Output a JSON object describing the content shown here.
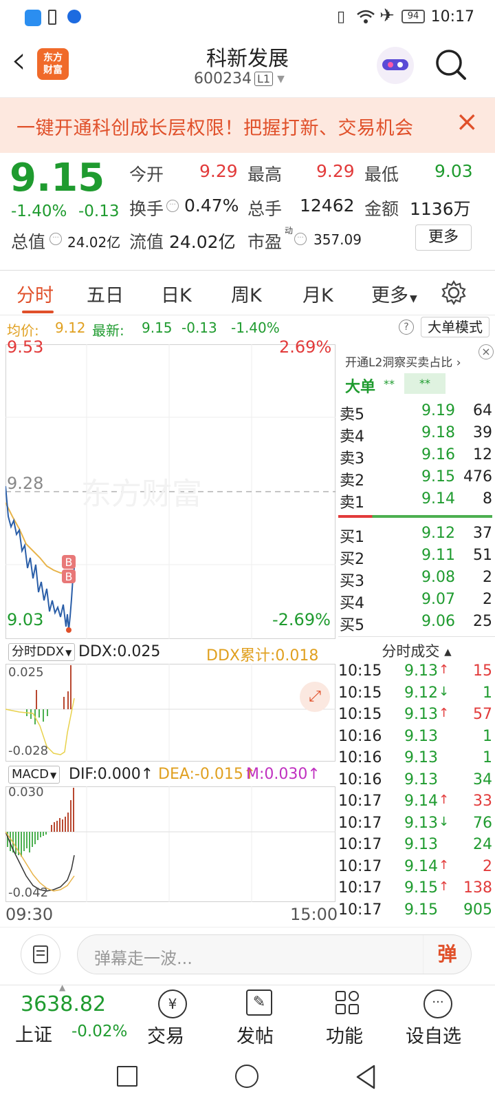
{
  "status_bar": {
    "time": "10:17",
    "battery": "94"
  },
  "header": {
    "back": "‹",
    "logo_line1": "东方",
    "logo_line2": "财富",
    "stock_name": "科新发展",
    "stock_code": "600234",
    "level": "L1"
  },
  "banner": {
    "text": "一键开通科创成长层权限！把握打新、交易机会",
    "close": "×"
  },
  "quote": {
    "price": "9.15",
    "change_pct": "-1.40%",
    "change": "-0.13",
    "open_label": "今开",
    "open": "9.29",
    "high_label": "最高",
    "high": "9.29",
    "low_label": "最低",
    "low": "9.03",
    "turnover_label": "换手",
    "turnover": "0.47%",
    "volume_label": "总手",
    "volume": "12462",
    "amount_label": "金额",
    "amount": "1136万",
    "mktcap_label": "总值",
    "mktcap": "24.02亿",
    "float_label": "流值",
    "float": "24.02亿",
    "pe_label": "市盈",
    "pe_sup": "动",
    "pe": "357.09",
    "more_label": "更多"
  },
  "tabs": [
    "分时",
    "五日",
    "日K",
    "周K",
    "月K",
    "更多"
  ],
  "infobar": {
    "avg_label": "均价:",
    "avg": "9.12",
    "latest_label": "最新:",
    "latest": "9.15",
    "chg": "-0.13",
    "chg_pct": "-1.40%",
    "mode_button": "大单模式"
  },
  "chart": {
    "price_top": "9.53",
    "price_mid": "9.28",
    "price_bottom": "9.03",
    "pct_top": "2.69%",
    "pct_bottom": "-2.69%",
    "watermark": "东方财富",
    "ddx_selector": "分时DDX",
    "ddx": "DDX:0.025",
    "ddx_cum": "DDX累计:0.018",
    "ddx_top": "0.025",
    "ddx_bottom": "-0.028",
    "macd_selector": "MACD",
    "dif": "DIF:0.000↑",
    "dea": "DEA:-0.015↑",
    "m": "M:0.030↑",
    "macd_top": "0.030",
    "macd_bottom": "-0.042",
    "time_start": "09:30",
    "time_end": "15:00",
    "b_marker": "B"
  },
  "orderbook": {
    "promo": "开通L2洞察买卖占比 ›",
    "big_label": "大单",
    "big_v1": "**",
    "big_v2": "**",
    "asks": [
      {
        "label": "卖5",
        "price": "9.19",
        "vol": "64"
      },
      {
        "label": "卖4",
        "price": "9.18",
        "vol": "39"
      },
      {
        "label": "卖3",
        "price": "9.16",
        "vol": "12"
      },
      {
        "label": "卖2",
        "price": "9.15",
        "vol": "476"
      },
      {
        "label": "卖1",
        "price": "9.14",
        "vol": "8"
      }
    ],
    "bids": [
      {
        "label": "买1",
        "price": "9.12",
        "vol": "37"
      },
      {
        "label": "买2",
        "price": "9.11",
        "vol": "51"
      },
      {
        "label": "买3",
        "price": "9.08",
        "vol": "2"
      },
      {
        "label": "买4",
        "price": "9.07",
        "vol": "2"
      },
      {
        "label": "买5",
        "price": "9.06",
        "vol": "25"
      }
    ],
    "trades_title": "分时成交 ▴",
    "trades": [
      {
        "time": "10:15",
        "price": "9.13",
        "arrow": "↑",
        "vol": "15"
      },
      {
        "time": "10:15",
        "price": "9.12",
        "arrow": "↓",
        "vol": "1"
      },
      {
        "time": "10:15",
        "price": "9.13",
        "arrow": "↑",
        "vol": "57"
      },
      {
        "time": "10:16",
        "price": "9.13",
        "arrow": "",
        "vol": "1"
      },
      {
        "time": "10:16",
        "price": "9.13",
        "arrow": "",
        "vol": "1"
      },
      {
        "time": "10:16",
        "price": "9.13",
        "arrow": "",
        "vol": "34"
      },
      {
        "time": "10:17",
        "price": "9.14",
        "arrow": "↑",
        "vol": "33"
      },
      {
        "time": "10:17",
        "price": "9.13",
        "arrow": "↓",
        "vol": "76"
      },
      {
        "time": "10:17",
        "price": "9.13",
        "arrow": "",
        "vol": "24"
      },
      {
        "time": "10:17",
        "price": "9.14",
        "arrow": "↑",
        "vol": "2"
      },
      {
        "time": "10:17",
        "price": "9.15",
        "arrow": "↑",
        "vol": "138"
      },
      {
        "time": "10:17",
        "price": "9.15",
        "arrow": "",
        "vol": "905"
      }
    ]
  },
  "comment": {
    "placeholder": "弹幕走一波...",
    "danmu": "弹"
  },
  "bottom_nav": {
    "index_value": "3638.82",
    "index_name": "上证",
    "index_chg": "-0.02%",
    "items": [
      "交易",
      "发帖",
      "功能",
      "设自选"
    ]
  }
}
